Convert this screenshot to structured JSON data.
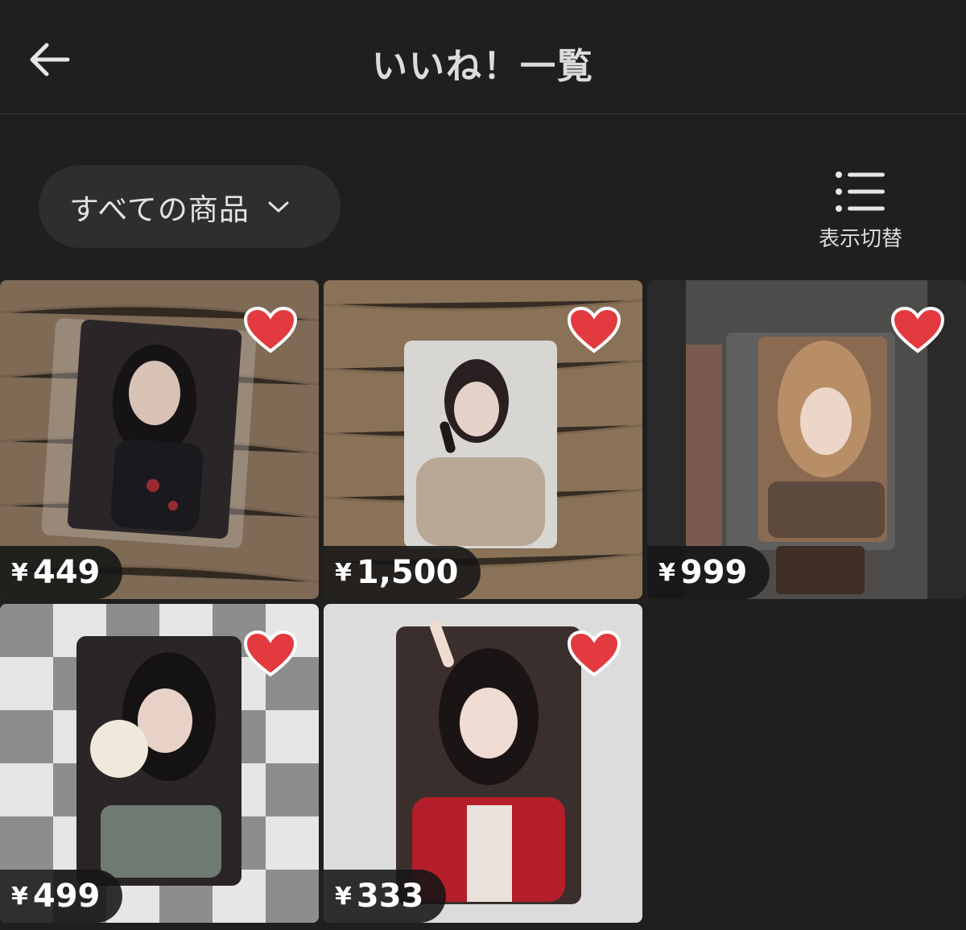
{
  "header": {
    "title": "いいね！一覧"
  },
  "filter": {
    "label": "すべての商品"
  },
  "view_toggle": {
    "label": "表示切替"
  },
  "colors": {
    "heart": "#e23a3f",
    "background": "#1f1f1f"
  },
  "items": [
    {
      "currency": "¥",
      "price": "449"
    },
    {
      "currency": "¥",
      "price": "1,500"
    },
    {
      "currency": "¥",
      "price": "999"
    },
    {
      "currency": "¥",
      "price": "499"
    },
    {
      "currency": "¥",
      "price": "333"
    }
  ]
}
